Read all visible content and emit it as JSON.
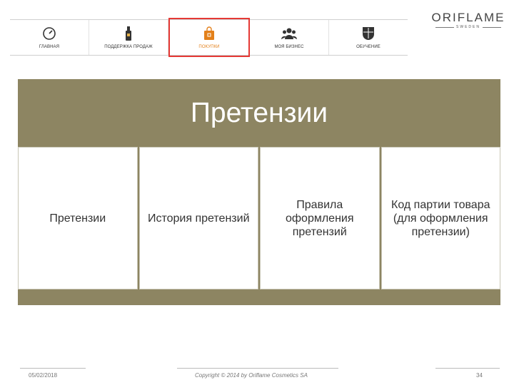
{
  "nav": {
    "items": [
      {
        "label": "главная",
        "icon": "speedometer-icon"
      },
      {
        "label": "поддержка продаж",
        "icon": "bottle-icon"
      },
      {
        "label": "покупки",
        "icon": "shopping-bag-icon",
        "active": true
      },
      {
        "label": "моя бизнес",
        "icon": "team-icon"
      },
      {
        "label": "обучение",
        "icon": "crest-icon"
      }
    ]
  },
  "logo": {
    "word": "ORIFLAME",
    "sub": "SWEDEN"
  },
  "banner": {
    "title": "Претензии"
  },
  "cards": [
    {
      "label": "Претензии"
    },
    {
      "label": "История претензий"
    },
    {
      "label": "Правила оформления претензий"
    },
    {
      "label": "Код партии товара (для оформления претензии)"
    }
  ],
  "footer": {
    "date": "05/02/2018",
    "copyright": "Copyright © 2014 by Oriflame Cosmetics SA",
    "page": "34"
  },
  "colors": {
    "banner": "#8d8562",
    "active_border": "#e53935",
    "active_icon": "#e3801a"
  }
}
